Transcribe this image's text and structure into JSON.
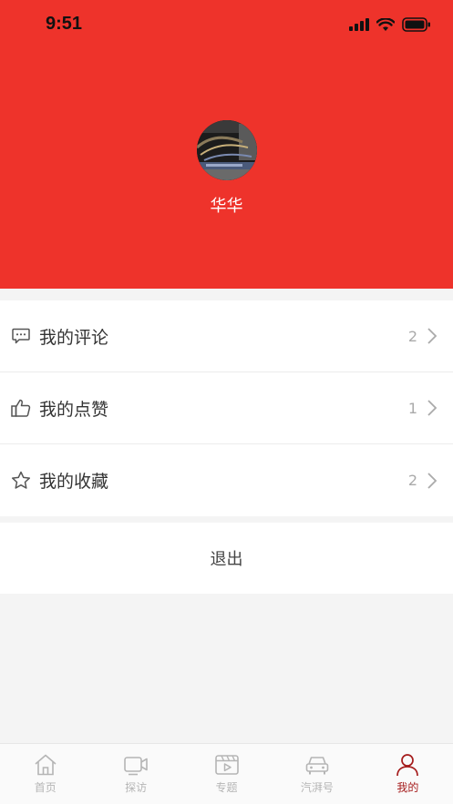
{
  "status_bar": {
    "time": "9:51"
  },
  "profile": {
    "username": "华华"
  },
  "menu": {
    "items": [
      {
        "label": "我的评论",
        "count": "2",
        "icon": "comment-icon"
      },
      {
        "label": "我的点赞",
        "count": "1",
        "icon": "thumbs-up-icon"
      },
      {
        "label": "我的收藏",
        "count": "2",
        "icon": "star-icon"
      }
    ]
  },
  "logout_label": "退出",
  "tabbar": {
    "tabs": [
      {
        "label": "首页",
        "icon": "home-icon",
        "active": false
      },
      {
        "label": "探访",
        "icon": "video-camera-icon",
        "active": false
      },
      {
        "label": "专题",
        "icon": "film-board-icon",
        "active": false
      },
      {
        "label": "汽湃号",
        "icon": "car-icon",
        "active": false
      },
      {
        "label": "我的",
        "icon": "person-icon",
        "active": true
      }
    ]
  },
  "colors": {
    "header_red": "#ee332b",
    "active_tab": "#a51c1c",
    "inactive_tab": "#b5b5b5"
  }
}
